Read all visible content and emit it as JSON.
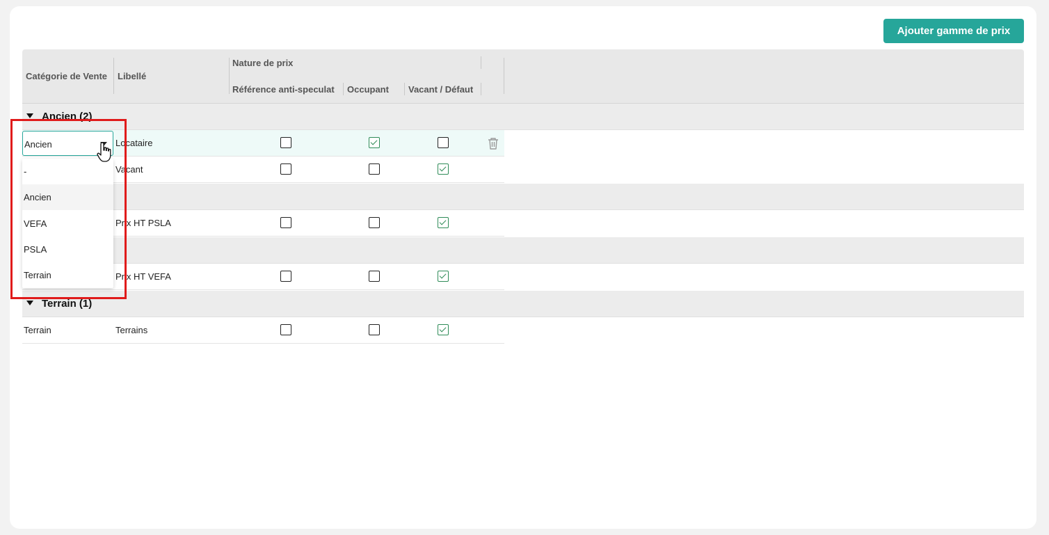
{
  "toolbar": {
    "add_button_label": "Ajouter gamme de prix"
  },
  "table": {
    "headers": {
      "categorie": "Catégorie de Vente",
      "libelle": "Libellé",
      "nature": "Nature de prix",
      "reference": "Référence anti-speculat",
      "occupant": "Occupant",
      "vacant": "Vacant / Défaut"
    },
    "groups": {
      "ancien": {
        "label": "Ancien (2)"
      },
      "terrain": {
        "label": "Terrain (1)"
      }
    },
    "rows": [
      {
        "categorie": "Ancien",
        "libelle": "Locataire",
        "reference": false,
        "occupant": true,
        "vacant": false
      },
      {
        "categorie": "",
        "libelle": "Vacant",
        "reference": false,
        "occupant": false,
        "vacant": true
      },
      {
        "categorie": "",
        "libelle": "Prix HT PSLA",
        "reference": false,
        "occupant": false,
        "vacant": true
      },
      {
        "categorie": "",
        "libelle": "Prix HT VEFA",
        "reference": false,
        "occupant": false,
        "vacant": true
      },
      {
        "categorie": "Terrain",
        "libelle": "Terrains",
        "reference": false,
        "occupant": false,
        "vacant": true
      }
    ]
  },
  "dropdown": {
    "current_value": "Ancien",
    "options": [
      "-",
      "Ancien",
      "VEFA",
      "PSLA",
      "Terrain"
    ],
    "selected_option": "Ancien"
  },
  "colors": {
    "accent": "#26a69a",
    "check": "#2e8b57",
    "highlight": "#e01b1b",
    "header_bg": "#e8e8e8"
  }
}
